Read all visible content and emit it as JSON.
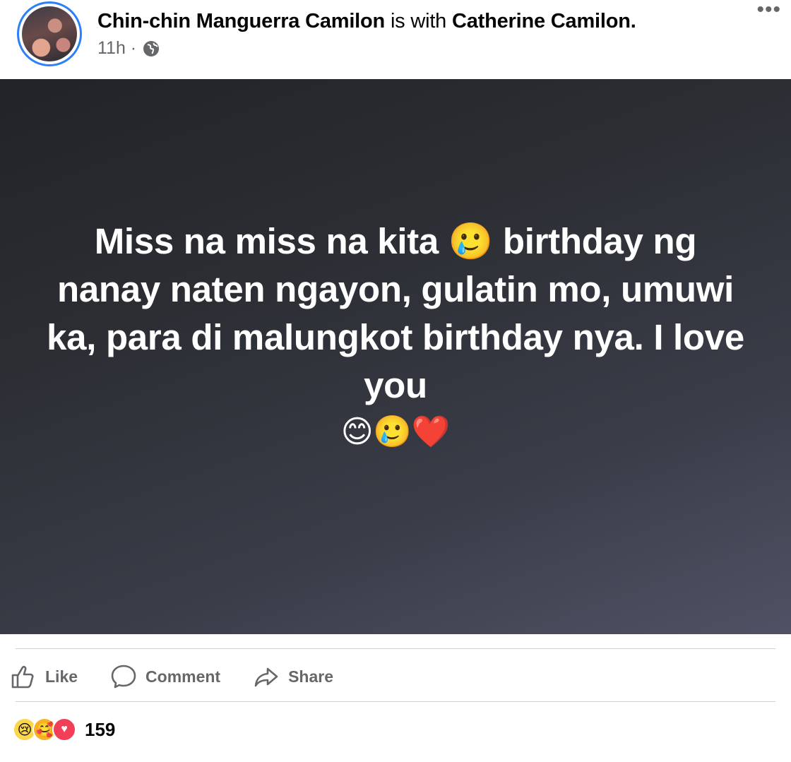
{
  "post": {
    "author": "Chin-chin Manguerra Camilon",
    "with_text": "is with",
    "tagged": "Catherine Camilon.",
    "time": "11h ·",
    "more_icon": "more-horizontal-icon",
    "privacy_icon": "globe-icon",
    "text": "Miss na miss na kita 🥲 birthday ng nanay naten ngayon, gulatin mo, umuwi ka, para di malungkot birthday nya. I love you",
    "emojis": "😊🥲❤️",
    "background_colors": [
      "#222327",
      "#4e5264"
    ]
  },
  "actions": {
    "like_label": "Like",
    "comment_label": "Comment",
    "share_label": "Share"
  },
  "reactions": {
    "icons": [
      "sad-reaction-icon",
      "care-reaction-icon",
      "love-reaction-icon"
    ],
    "count": "159"
  },
  "colors": {
    "avatar_ring": "#2d7ff9",
    "secondary_text": "#65676b"
  }
}
